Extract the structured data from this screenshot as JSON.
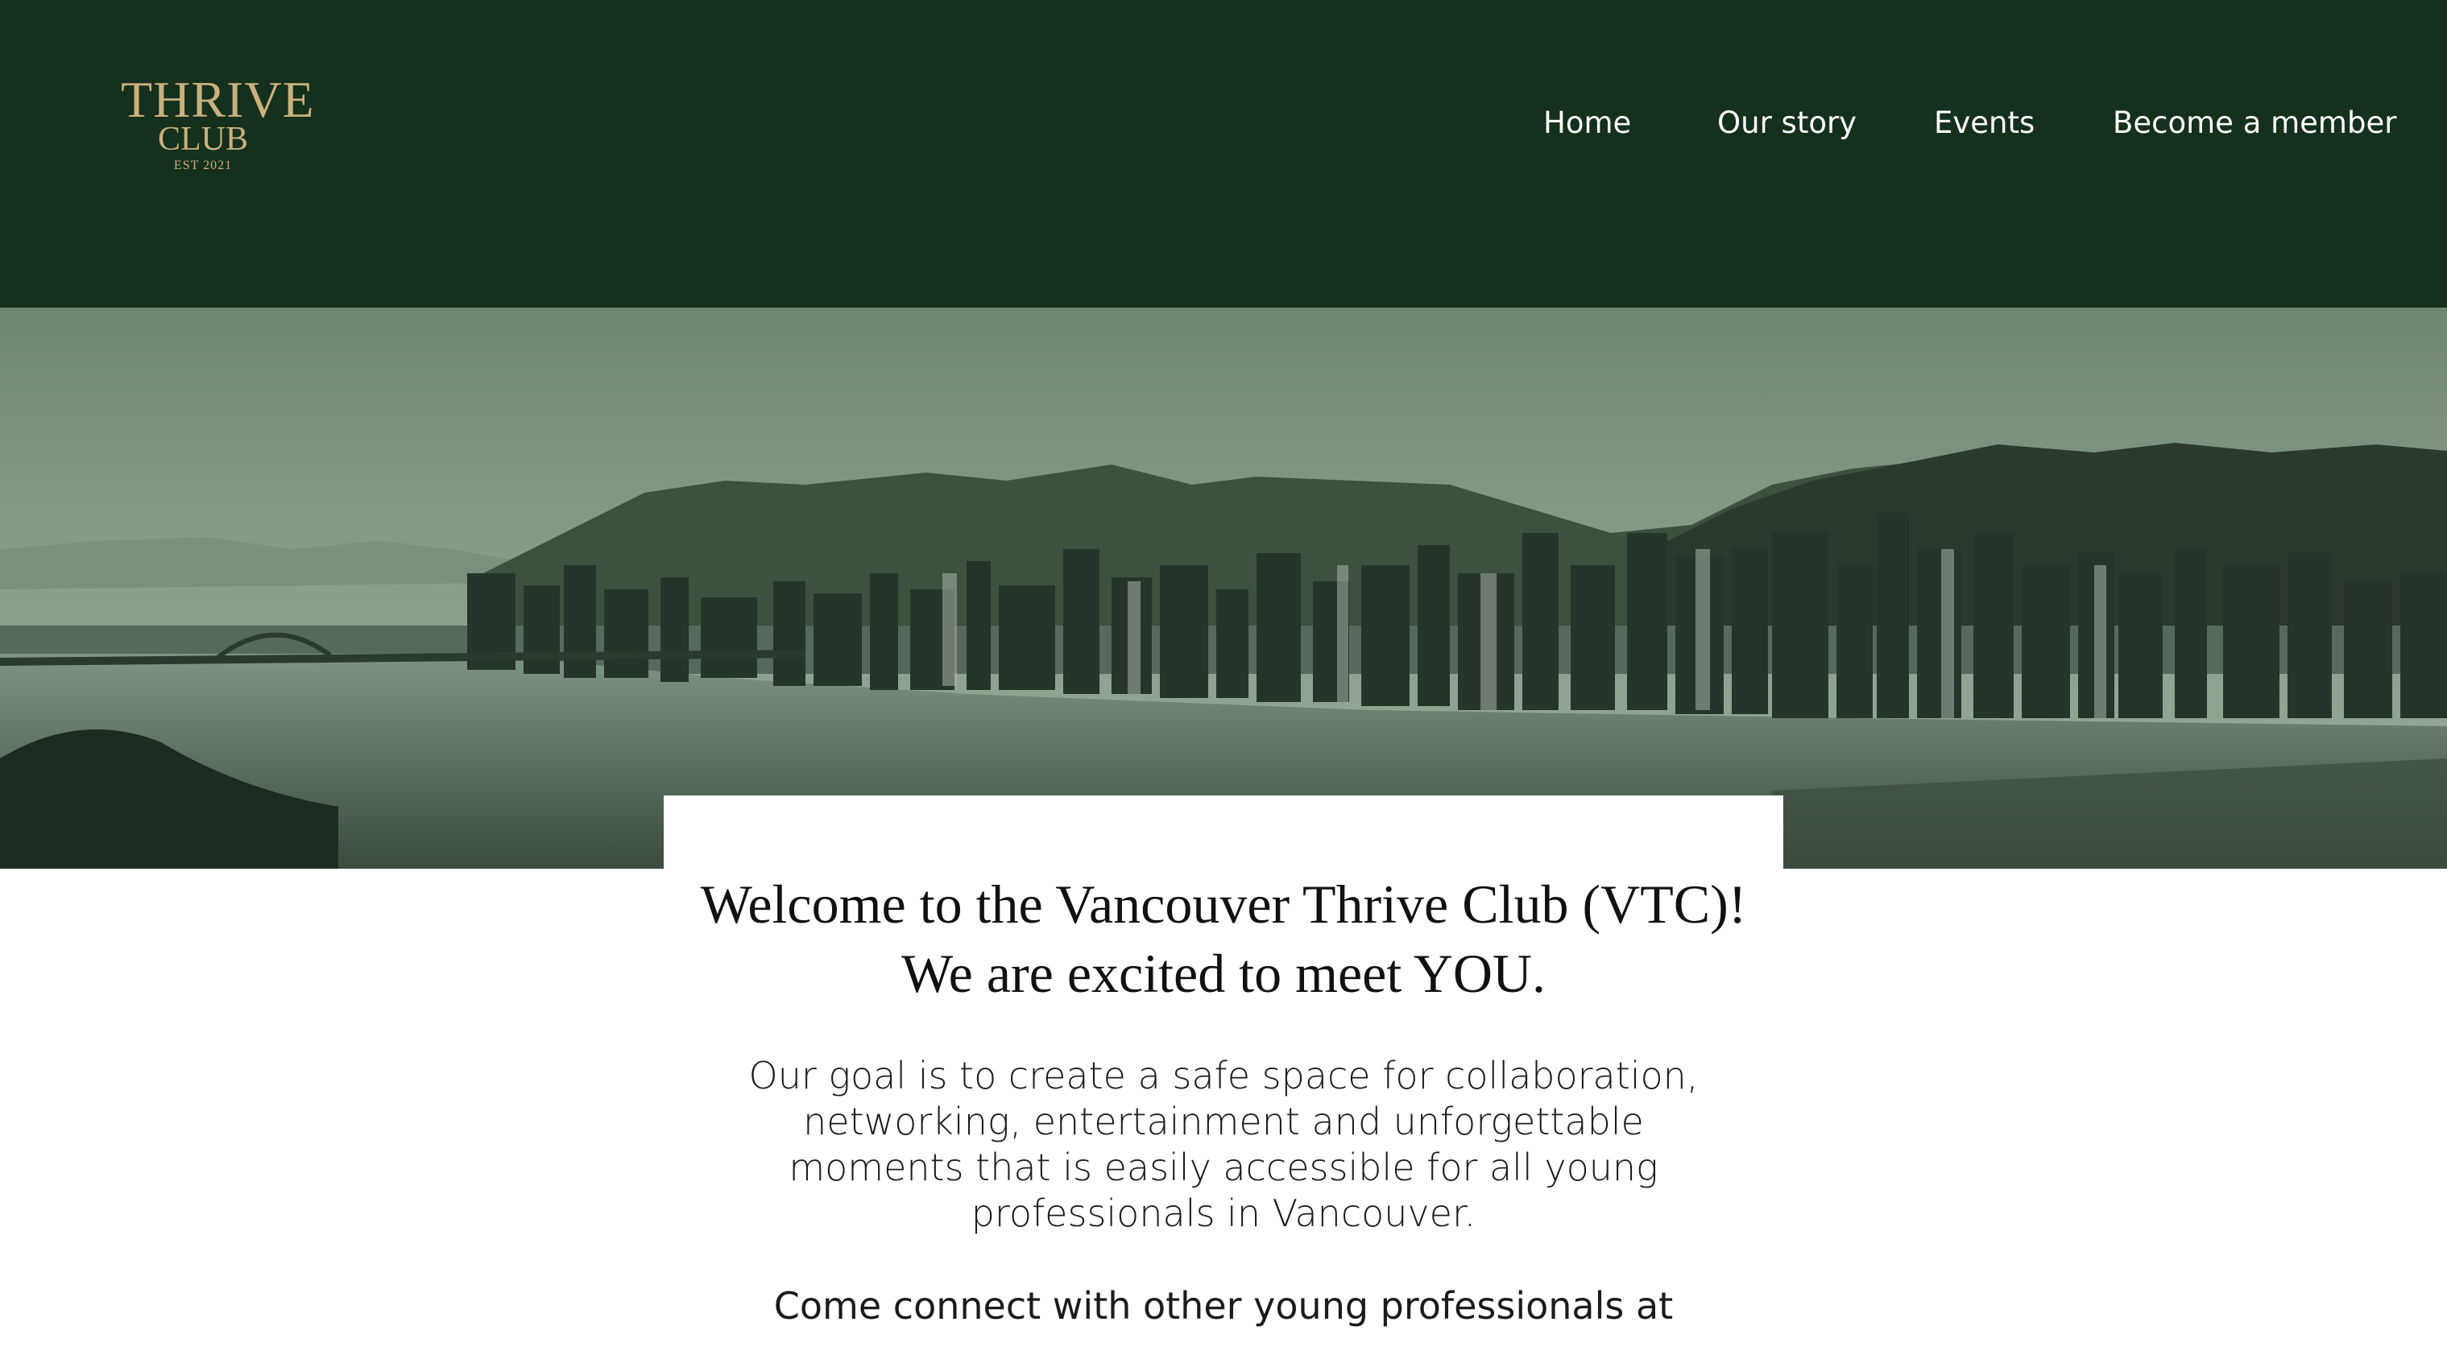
{
  "logo": {
    "line1": "THRIVE",
    "line2": "CLUB",
    "line3": "EST 2021",
    "color": "#c9b07e"
  },
  "nav": {
    "items": [
      {
        "label": "Home"
      },
      {
        "label": "Our story"
      },
      {
        "label": "Events"
      },
      {
        "label": "Become a member"
      }
    ]
  },
  "hero": {
    "image": "vancouver-skyline-photo"
  },
  "main": {
    "welcome_line1": "Welcome to the Vancouver Thrive Club (VTC)!",
    "welcome_line2": "We are excited to meet YOU.",
    "goal_line1": "Our goal is to create a safe space for collaboration,",
    "goal_line2": "networking, entertainment and unforgettable",
    "goal_line3": "moments that is easily accessible for all young",
    "goal_line4": "professionals in Vancouver.",
    "come_connect": "Come connect with other young professionals at"
  },
  "colors": {
    "header_bg": "#15301c",
    "nav_text": "#ffffff",
    "body_bg": "#ffffff"
  }
}
